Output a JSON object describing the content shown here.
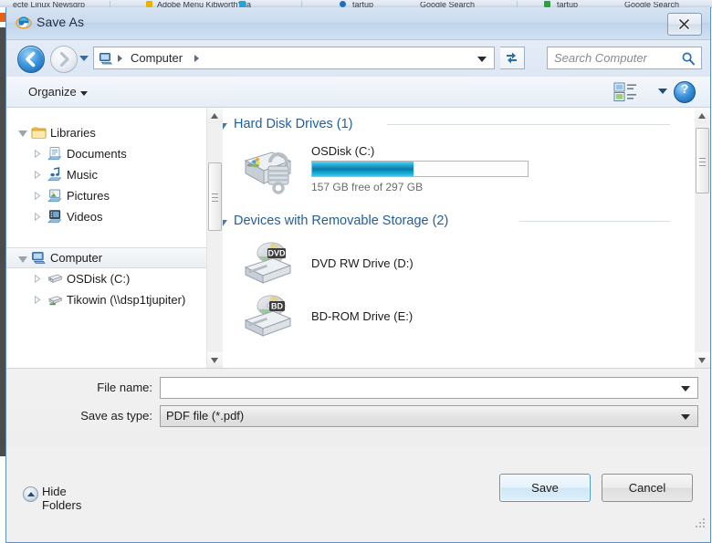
{
  "background": {
    "tab_fragments": [
      "ecte Linux Newsgrp",
      "Adobe Menu Kibworth?fla",
      "tartup",
      "Google Search",
      "tartup",
      "Google Search"
    ]
  },
  "window": {
    "title": "Save As",
    "title_icon": "internet-explorer-icon",
    "close_label": "Close"
  },
  "navigation": {
    "back_icon": "back-arrow-icon",
    "forward_icon": "forward-arrow-icon",
    "history_icon": "chevron-down-icon",
    "address_icon": "computer-icon",
    "breadcrumb": "Computer",
    "address_dropdown_icon": "chevron-down-icon",
    "refresh_icon": "refresh-icon",
    "search_placeholder": "Search Computer",
    "search_value": "",
    "search_icon": "search-icon"
  },
  "toolbar": {
    "organize_label": "Organize",
    "views_icon": "views-layout-icon",
    "help_icon": "help-icon",
    "help_glyph": "?"
  },
  "sidebar": {
    "items": [
      {
        "label": "Libraries",
        "icon": "libraries-folder-icon",
        "indent": 0,
        "expander": "open",
        "selected": false
      },
      {
        "label": "Documents",
        "icon": "documents-library-icon",
        "indent": 1,
        "expander": "closed",
        "selected": false
      },
      {
        "label": "Music",
        "icon": "music-library-icon",
        "indent": 1,
        "expander": "closed",
        "selected": false
      },
      {
        "label": "Pictures",
        "icon": "pictures-library-icon",
        "indent": 1,
        "expander": "closed",
        "selected": false
      },
      {
        "label": "Videos",
        "icon": "videos-library-icon",
        "indent": 1,
        "expander": "closed",
        "selected": false
      },
      {
        "label": "Computer",
        "icon": "computer-icon",
        "indent": 0,
        "expander": "open",
        "selected": true
      },
      {
        "label": "OSDisk (C:)",
        "icon": "hard-drive-icon",
        "indent": 1,
        "expander": "closed",
        "selected": false
      },
      {
        "label": "Tikowin (\\\\dsp1tjupiter)",
        "icon": "network-drive-icon",
        "indent": 1,
        "expander": "closed",
        "selected": false
      }
    ]
  },
  "content": {
    "groups": [
      {
        "title": "Hard Disk Drives (1)",
        "drives": [
          {
            "name": "OSDisk (C:)",
            "icon": "bitlocker-hard-drive-icon",
            "capacity_text": "157 GB free of 297 GB",
            "free_gb": 157,
            "total_gb": 297,
            "used_percent": 47,
            "bar_color": "#11a9d6"
          }
        ]
      },
      {
        "title": "Devices with Removable Storage (2)",
        "drives": [
          {
            "name": "DVD RW Drive (D:)",
            "icon": "dvd-drive-icon",
            "badge": "DVD"
          },
          {
            "name": "BD-ROM Drive (E:)",
            "icon": "bd-rom-drive-icon",
            "badge": "BD"
          }
        ]
      }
    ]
  },
  "form": {
    "filename_label": "File name:",
    "filename_value": "",
    "filetype_label": "Save as type:",
    "filetype_value": "PDF file (*.pdf)"
  },
  "footer": {
    "hide_folders_label": "Hide Folders",
    "hide_folders_icon": "chevron-up-circle-icon",
    "save_label": "Save",
    "cancel_label": "Cancel",
    "resize_grip_icon": "resize-grip-icon"
  },
  "colors": {
    "accent_blue": "#215e9e",
    "capacity_bar": "#11a9d6",
    "title_bar": "#cbdcef",
    "default_button_border": "#4a9bd4"
  }
}
